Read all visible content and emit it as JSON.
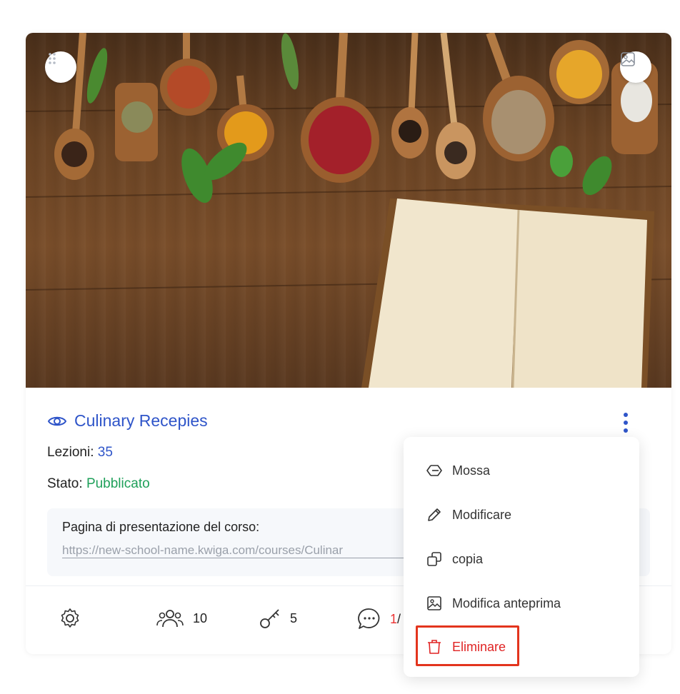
{
  "course": {
    "title": "Culinary Recepies",
    "lessons_label": "Lezioni:",
    "lessons_value": "35",
    "status_label": "Stato:",
    "status_value": "Pubblicato",
    "landing_label": "Pagina di presentazione del corso:",
    "landing_url": "https://new-school-name.kwiga.com/courses/Culinar"
  },
  "stats": {
    "participants": "10",
    "keys": "5",
    "comments_new": "1",
    "comments_sep": "/"
  },
  "menu": {
    "items": [
      {
        "label": "Mossa",
        "icon": "move-icon"
      },
      {
        "label": "Modificare",
        "icon": "pencil-icon"
      },
      {
        "label": "copia",
        "icon": "copy-icon"
      },
      {
        "label": "Modifica anteprima",
        "icon": "image-icon"
      },
      {
        "label": "Eliminare",
        "icon": "trash-icon"
      }
    ]
  },
  "colors": {
    "accent": "#2f55c9",
    "published": "#1fa05a",
    "danger": "#e02424",
    "highlight": "#e3341d"
  }
}
